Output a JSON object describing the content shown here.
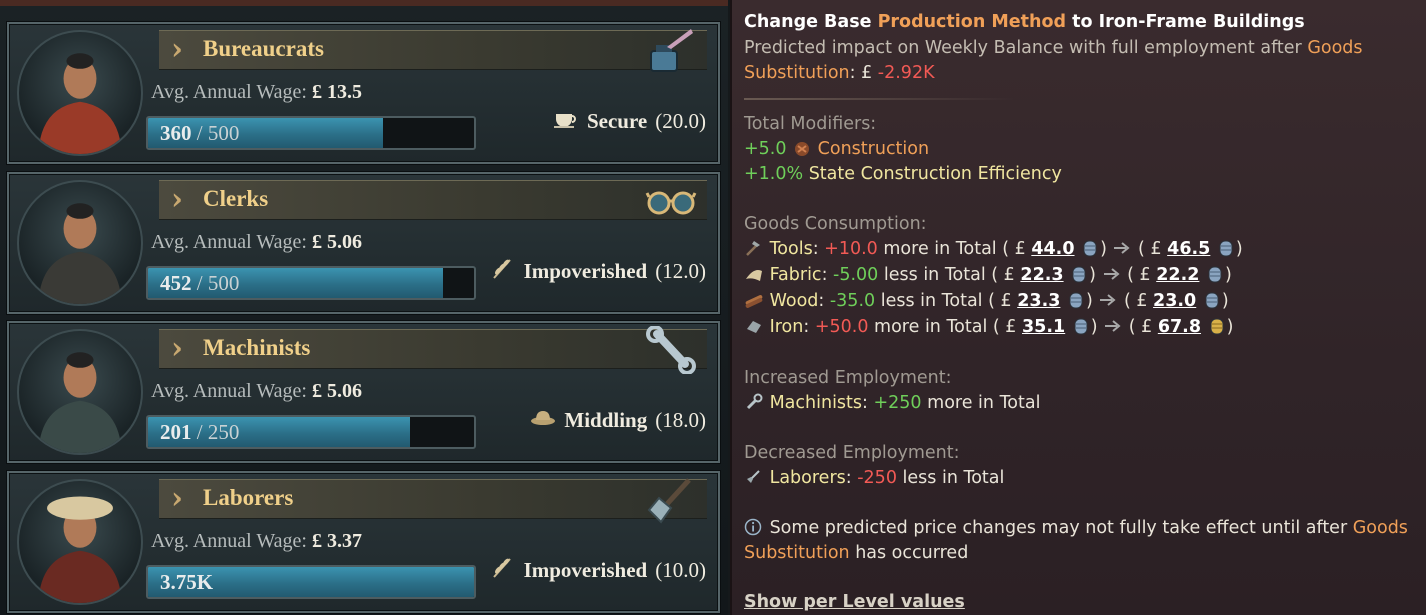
{
  "pops": [
    {
      "name": "Bureaucrats",
      "icon": "inkwell-icon",
      "wage_label": "Avg. Annual Wage:",
      "wage": "£ 13.5",
      "employed": "360",
      "capacity": "/ 500",
      "fill_fraction": 0.72,
      "status": "Secure",
      "status_value": "(20.0)",
      "status_icon": "teacup-icon",
      "portrait": "bureaucrat-portrait"
    },
    {
      "name": "Clerks",
      "icon": "spectacles-icon",
      "wage_label": "Avg. Annual Wage:",
      "wage": "£ 5.06",
      "employed": "452",
      "capacity": "/ 500",
      "fill_fraction": 0.904,
      "status": "Impoverished",
      "status_value": "(12.0)",
      "status_icon": "grain-icon",
      "portrait": "clerk-portrait"
    },
    {
      "name": "Machinists",
      "icon": "wrench-icon",
      "wage_label": "Avg. Annual Wage:",
      "wage": "£ 5.06",
      "employed": "201",
      "capacity": "/ 250",
      "fill_fraction": 0.804,
      "status": "Middling",
      "status_value": "(18.0)",
      "status_icon": "hat-icon",
      "portrait": "machinist-portrait"
    },
    {
      "name": "Laborers",
      "icon": "shovel-icon",
      "wage_label": "Avg. Annual Wage:",
      "wage": "£ 3.37",
      "employed": "3.75K",
      "capacity": "",
      "fill_fraction": 1.0,
      "status": "Impoverished",
      "status_value": "(10.0)",
      "status_icon": "grain-icon",
      "portrait": "laborer-portrait"
    }
  ],
  "tooltip": {
    "title_a": "Change Base ",
    "title_b": "Production Method",
    "title_c": " to Iron-Frame Buildings",
    "impact_a": "Predicted impact on Weekly Balance with full employment after ",
    "impact_goods": "Goods",
    "impact_sub": "Substitution",
    "impact_colon": ": ",
    "impact_cur": "£ ",
    "impact_val": "-2.92K",
    "modifiers_header": "Total Modifiers:",
    "mod1_val": "+5.0",
    "mod1_label": "Construction",
    "mod2_val": "+1.0%",
    "mod2_label": "State Construction Efficiency",
    "goods_header": "Goods Consumption:",
    "goods": [
      {
        "name": "Tools",
        "icon": "tools-icon",
        "delta": "+10.0",
        "delta_kind": "rd",
        "word": "more in Total",
        "from": "44.0",
        "to": "46.5"
      },
      {
        "name": "Fabric",
        "icon": "fabric-icon",
        "delta": "-5.00",
        "delta_kind": "gr",
        "word": "less in Total",
        "from": "22.3",
        "to": "22.2"
      },
      {
        "name": "Wood",
        "icon": "wood-icon",
        "delta": "-35.0",
        "delta_kind": "gr",
        "word": "less in Total",
        "from": "23.3",
        "to": "23.0"
      },
      {
        "name": "Iron",
        "icon": "iron-icon",
        "delta": "+50.0",
        "delta_kind": "rd",
        "word": "more in Total",
        "from": "35.1",
        "to": "67.8"
      }
    ],
    "inc_header": "Increased Employment:",
    "inc_name": "Machinists",
    "inc_val": "+250",
    "inc_word": "more in Total",
    "dec_header": "Decreased Employment:",
    "dec_name": "Laborers",
    "dec_val": "-250",
    "dec_word": "less in Total",
    "note_a": "Some predicted price changes may not fully take effect until after ",
    "note_goods": "Goods",
    "note_sub": "Substitution",
    "note_b": " has occurred",
    "link": "Show per Level values",
    "cur": "£"
  }
}
